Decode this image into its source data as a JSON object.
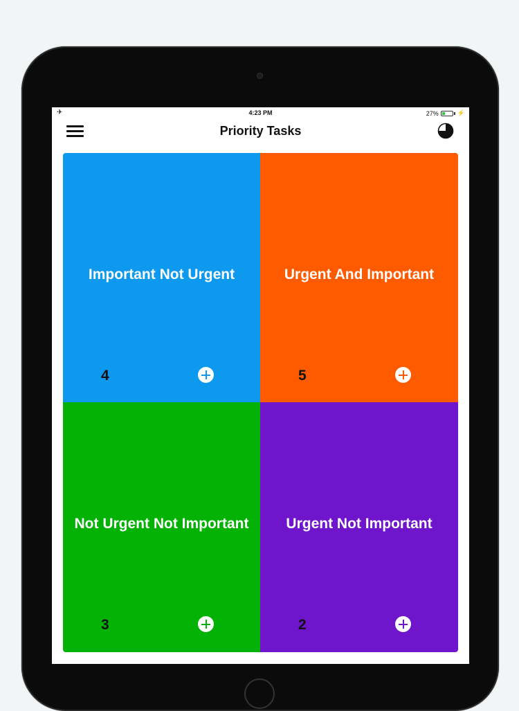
{
  "status_bar": {
    "time": "4:23 PM",
    "battery_percent": "27%",
    "airplane_icon": "airplane-icon",
    "battery_icon": "battery-icon",
    "charging_icon": "charging-bolt-icon"
  },
  "nav": {
    "title": "Priority Tasks",
    "menu_icon": "hamburger-menu-icon",
    "chart_icon": "pie-chart-icon"
  },
  "quadrants": [
    {
      "title": "Important Not Urgent",
      "count": "4",
      "color": "#0d99ee"
    },
    {
      "title": "Urgent And Important",
      "count": "5",
      "color": "#fe5a00"
    },
    {
      "title": "Not Urgent Not Important",
      "count": "3",
      "color": "#03b205"
    },
    {
      "title": "Urgent Not Important",
      "count": "2",
      "color": "#6f16cc"
    }
  ]
}
